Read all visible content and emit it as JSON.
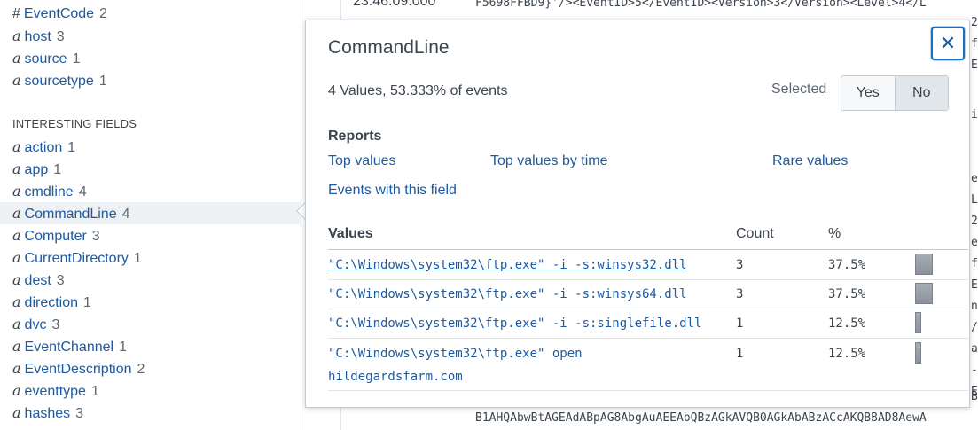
{
  "sidebar": {
    "fields": [
      {
        "type": "#",
        "name": "EventCode",
        "count": "2"
      },
      {
        "type": "a",
        "name": "host",
        "count": "3"
      },
      {
        "type": "a",
        "name": "source",
        "count": "1"
      },
      {
        "type": "a",
        "name": "sourcetype",
        "count": "1"
      }
    ],
    "interesting_title": "INTERESTING FIELDS",
    "interesting": [
      {
        "type": "a",
        "name": "action",
        "count": "1"
      },
      {
        "type": "a",
        "name": "app",
        "count": "1"
      },
      {
        "type": "a",
        "name": "cmdline",
        "count": "4"
      },
      {
        "type": "a",
        "name": "CommandLine",
        "count": "4"
      },
      {
        "type": "a",
        "name": "Computer",
        "count": "3"
      },
      {
        "type": "a",
        "name": "CurrentDirectory",
        "count": "1"
      },
      {
        "type": "a",
        "name": "dest",
        "count": "3"
      },
      {
        "type": "a",
        "name": "direction",
        "count": "1"
      },
      {
        "type": "a",
        "name": "dvc",
        "count": "3"
      },
      {
        "type": "a",
        "name": "EventChannel",
        "count": "1"
      },
      {
        "type": "a",
        "name": "EventDescription",
        "count": "2"
      },
      {
        "type": "a",
        "name": "eventtype",
        "count": "1"
      },
      {
        "type": "a",
        "name": "hashes",
        "count": "3"
      }
    ]
  },
  "events": {
    "time": "23:46:09.000",
    "line1": "F5698FFBD9}'/><EventID>5</EventID><Version>3</Version><Level>4</L",
    "bottom_line": "B1AHQAbwBtAGEAdABpAG8AbgAuAEEAbQBzAGkAVQB0AGkAbABzACcAKQB8AD8AewA",
    "right_chars": [
      "2",
      "f",
      "E",
      "i",
      "e",
      "L",
      "2",
      "e",
      "f",
      "E",
      "n",
      "/",
      "a",
      "-",
      "E",
      "B"
    ]
  },
  "popup": {
    "title": "CommandLine",
    "close_symbol": "✕",
    "summary": "4 Values, 53.333% of events",
    "selected_label": "Selected",
    "toggle": {
      "yes": "Yes",
      "no": "No"
    },
    "reports_title": "Reports",
    "reports": {
      "top_values": "Top values",
      "top_values_by_time": "Top values by time",
      "rare_values": "Rare values",
      "events_with_field": "Events with this field"
    },
    "table": {
      "headers": {
        "values": "Values",
        "count": "Count",
        "pct": "%"
      },
      "rows": [
        {
          "value": "\"C:\\Windows\\system32\\ftp.exe\" -i -s:winsys32.dll",
          "count": "3",
          "pct": "37.5%",
          "fraction": 0.375
        },
        {
          "value": "\"C:\\Windows\\system32\\ftp.exe\" -i -s:winsys64.dll",
          "count": "3",
          "pct": "37.5%",
          "fraction": 0.375
        },
        {
          "value": "\"C:\\Windows\\system32\\ftp.exe\" -i -s:singlefile.dll",
          "count": "1",
          "pct": "12.5%",
          "fraction": 0.125
        },
        {
          "value": "\"C:\\Windows\\system32\\ftp.exe\" open",
          "value_cont": "hildegardsfarm.com",
          "count": "1",
          "pct": "12.5%",
          "fraction": 0.125
        }
      ]
    }
  }
}
